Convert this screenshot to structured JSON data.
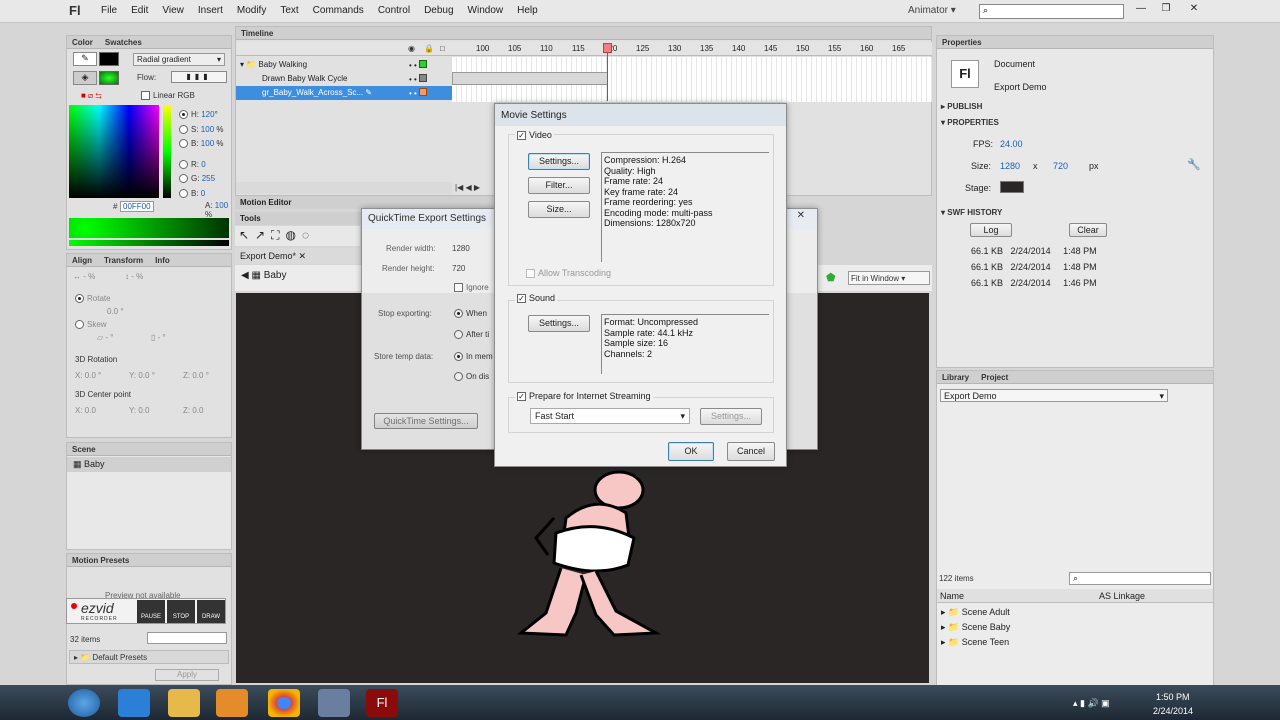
{
  "menubar": {
    "logo": "Fl",
    "items": [
      "File",
      "Edit",
      "View",
      "Insert",
      "Modify",
      "Text",
      "Commands",
      "Control",
      "Debug",
      "Window",
      "Help"
    ],
    "workspace": "Animator"
  },
  "color_panel": {
    "tabs": [
      "Color",
      "Swatches"
    ],
    "fill_type": "Radial gradient",
    "flow_label": "Flow:",
    "linear_rgb": "Linear RGB",
    "hsb": {
      "h_label": "H:",
      "h": "120",
      "h_unit": "°",
      "s_label": "S:",
      "s": "100",
      "s_unit": "%",
      "b_label": "B:",
      "b": "100",
      "b_unit": "%"
    },
    "rgb": {
      "r_label": "R:",
      "r": "0",
      "g_label": "G:",
      "g": "255",
      "b_label": "B:",
      "b": "0",
      "a_label": "A:",
      "a": "100",
      "a_unit": "%"
    },
    "hex_label": "#",
    "hex": "00FF00"
  },
  "transform_panel": {
    "tabs": [
      "Align",
      "Transform",
      "Info"
    ],
    "width_pct": "%",
    "height_pct": "%",
    "rotate": "Rotate",
    "rotate_val": "0.0 °",
    "skew": "Skew",
    "skew_x": "°",
    "skew_y": "°",
    "rot3d": "3D Rotation",
    "rot3d_x": "0.0 °",
    "rot3d_y": "0.0 °",
    "rot3d_z": "0.0 °",
    "center3d": "3D Center point",
    "center_x": "0.0",
    "center_y": "0.0",
    "center_z": "0.0",
    "x_label": "X:",
    "y_label": "Y:",
    "z_label": "Z:"
  },
  "scene_panel": {
    "title": "Scene",
    "items": [
      "Baby"
    ]
  },
  "motion_presets": {
    "title": "Motion Presets",
    "preview": "Preview not available",
    "count": "32 items",
    "folder": "Default Presets",
    "apply": "Apply"
  },
  "ezvid": {
    "brand": "ezvid",
    "sub": "RECORDER",
    "pause": "PAUSE",
    "stop": "STOP",
    "draw": "DRAW"
  },
  "timeline": {
    "title": "Timeline",
    "frame_numbers": [
      "100",
      "105",
      "110",
      "115",
      "120",
      "125",
      "130",
      "135",
      "140",
      "145",
      "150",
      "155",
      "160",
      "165"
    ],
    "layers": [
      "Baby Walking",
      "Drawn Baby Walk Cycle",
      "gr_Baby_Walk_Across_Sc..."
    ],
    "motion_editor": "Motion Editor",
    "tools": "Tools"
  },
  "document": {
    "tab": "Export Demo*",
    "scene": "Baby",
    "zoom": "Fit in Window"
  },
  "properties": {
    "title": "Properties",
    "type": "Document",
    "name": "Export Demo",
    "publish": "PUBLISH",
    "section": "PROPERTIES",
    "fps_label": "FPS:",
    "fps": "24.00",
    "size_label": "Size:",
    "width": "1280",
    "x": "x",
    "height": "720",
    "px": "px",
    "stage_label": "Stage:",
    "swf_history": "SWF HISTORY",
    "log": "Log",
    "clear": "Clear",
    "history": [
      {
        "size": "66.1 KB",
        "date": "2/24/2014",
        "time": "1:48 PM"
      },
      {
        "size": "66.1 KB",
        "date": "2/24/2014",
        "time": "1:48 PM"
      },
      {
        "size": "66.1 KB",
        "date": "2/24/2014",
        "time": "1:46 PM"
      }
    ]
  },
  "library": {
    "tabs": [
      "Library",
      "Project"
    ],
    "document": "Export Demo",
    "count": "122 items",
    "col_name": "Name",
    "col_linkage": "AS Linkage",
    "items": [
      "Scene Adult",
      "Scene Baby",
      "Scene Teen"
    ]
  },
  "qt_dialog": {
    "title": "QuickTime Export Settings",
    "render_width_label": "Render width:",
    "render_width": "1280",
    "render_height_label": "Render height:",
    "render_height": "720",
    "ignore": "Ignore",
    "stop_label": "Stop exporting:",
    "when": "When",
    "after": "After ti",
    "store_label": "Store temp data:",
    "in_mem": "In mem",
    "on_disk": "On dis",
    "qt_settings": "QuickTime Settings..."
  },
  "movie_dialog": {
    "title": "Movie Settings",
    "video": "Video",
    "settings": "Settings...",
    "filter": "Filter...",
    "size": "Size...",
    "video_info": [
      "Compression: H.264",
      "Quality: High",
      "Frame rate: 24",
      "Key frame rate: 24",
      "Frame reordering: yes",
      "Encoding mode: multi-pass",
      "Dimensions: 1280x720"
    ],
    "allow_transcoding": "Allow Transcoding",
    "sound": "Sound",
    "sound_settings": "Settings...",
    "sound_info": [
      "Format: Uncompressed",
      "Sample rate: 44.1 kHz",
      "Sample size: 16",
      "Channels: 2"
    ],
    "streaming": "Prepare for Internet Streaming",
    "stream_option": "Fast Start",
    "stream_settings": "Settings...",
    "ok": "OK",
    "cancel": "Cancel"
  },
  "taskbar": {
    "time": "1:50 PM",
    "date": "2/24/2014"
  },
  "colors": {
    "accent": "#00ff00",
    "playhead": "#e03030",
    "stage_bg": "#2b2626"
  }
}
